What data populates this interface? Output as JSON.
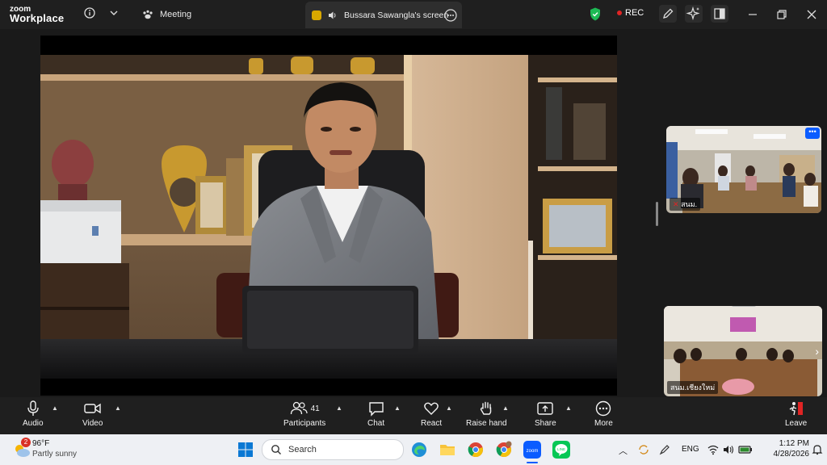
{
  "app": {
    "brand_line1": "zoom",
    "brand_line2": "Workplace"
  },
  "topbar": {
    "meeting_label": "Meeting",
    "screen_tab_label": "Bussara Sawangla's screen",
    "rec_label": "REC"
  },
  "thumbnails": [
    {
      "label": "สนม."
    },
    {
      "label": "สนม.เชียงใหม่"
    }
  ],
  "controls": {
    "audio": "Audio",
    "video": "Video",
    "participants": "Participants",
    "participants_count": "41",
    "chat": "Chat",
    "react": "React",
    "raise_hand": "Raise hand",
    "share": "Share",
    "more": "More",
    "leave": "Leave"
  },
  "taskbar": {
    "weather_temp": "96°F",
    "weather_desc": "Partly sunny",
    "weather_badge": "2",
    "search_placeholder": "Search",
    "lang": "ENG",
    "time": "1:12 PM",
    "date": "4/28/2026"
  },
  "colors": {
    "zoom_blue": "#0b5cff",
    "rec_red": "#e02424",
    "leave_red": "#e02424",
    "shield_green": "#1db954"
  }
}
